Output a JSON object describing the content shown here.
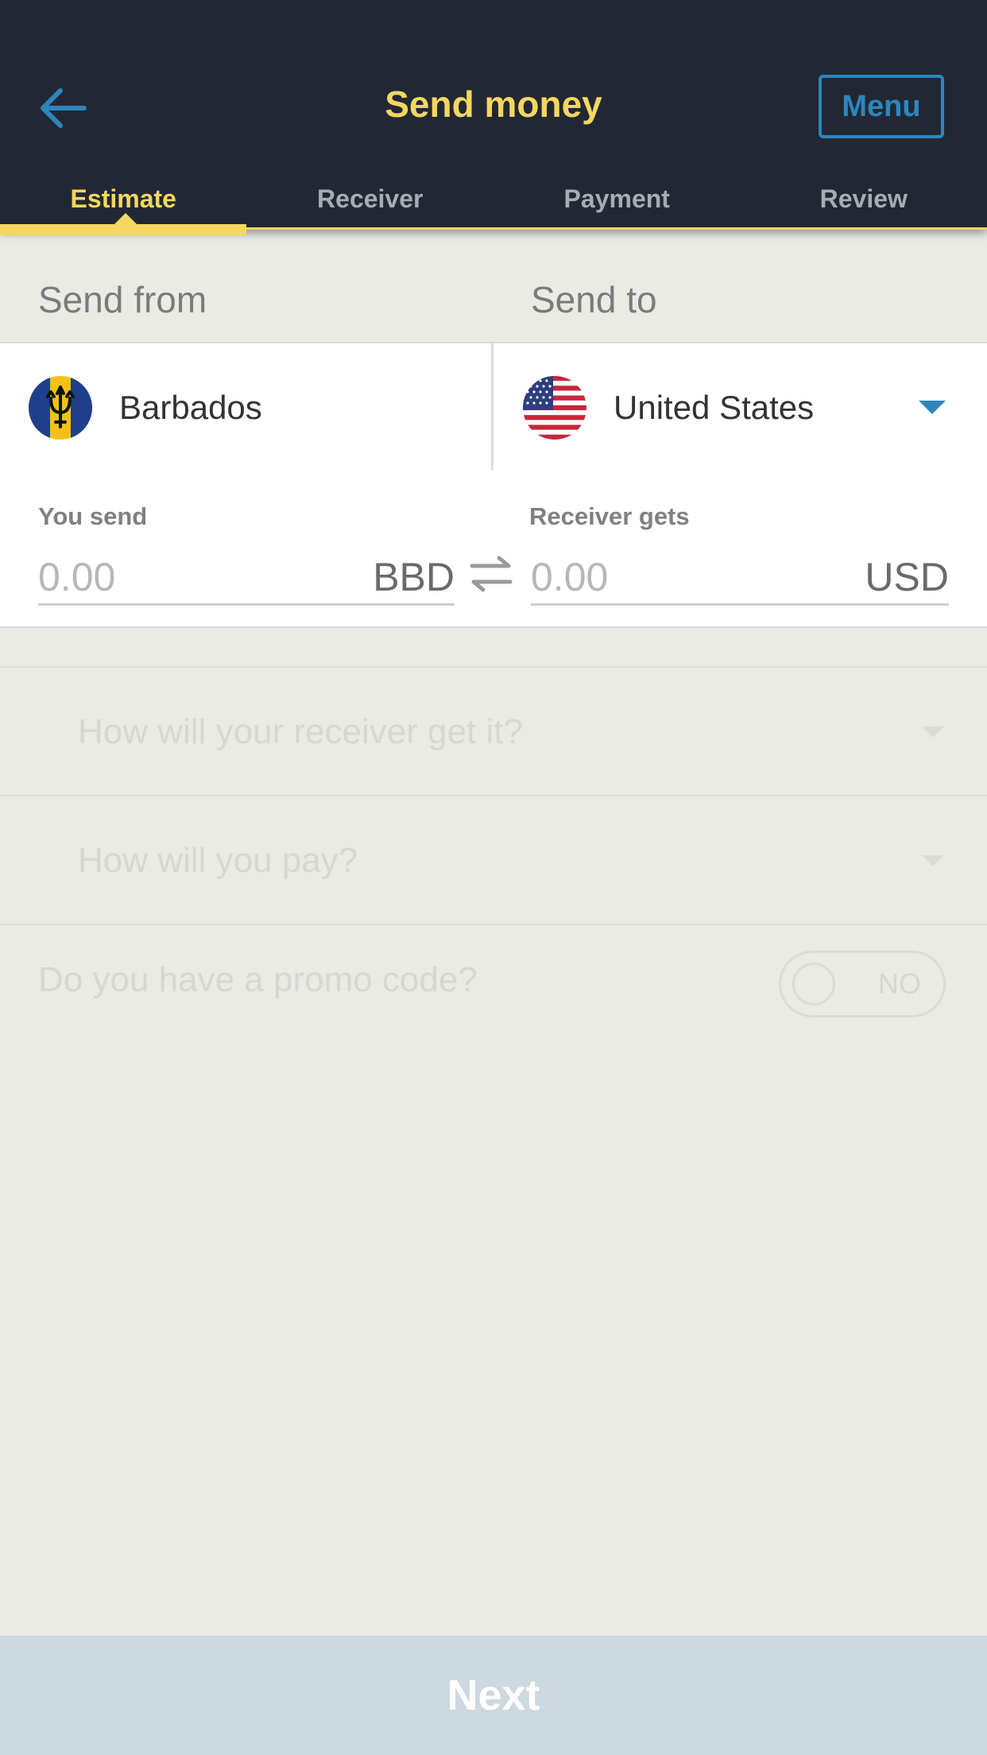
{
  "header": {
    "title": "Send money",
    "menu_label": "Menu",
    "back_icon": "arrow-left-icon"
  },
  "tabs": [
    {
      "label": "Estimate",
      "active": true
    },
    {
      "label": "Receiver",
      "active": false
    },
    {
      "label": "Payment",
      "active": false
    },
    {
      "label": "Review",
      "active": false
    }
  ],
  "countries": {
    "send_from_label": "Send from",
    "send_to_label": "Send to",
    "from": {
      "name": "Barbados",
      "flag": "barbados-flag"
    },
    "to": {
      "name": "United States",
      "flag": "us-flag"
    }
  },
  "amounts": {
    "send": {
      "label": "You send",
      "placeholder": "0.00",
      "currency": "BBD"
    },
    "receive": {
      "label": "Receiver gets",
      "placeholder": "0.00",
      "currency": "USD"
    }
  },
  "options": {
    "delivery": "How will your receiver get it?",
    "payment": "How will you pay?",
    "promo": {
      "label": "Do you have a promo code?",
      "toggle_text": "NO"
    }
  },
  "next_label": "Next",
  "colors": {
    "header_bg": "#222833",
    "accent_yellow": "#f4d760",
    "accent_blue": "#2d86c0",
    "next_bg": "#ccd9de"
  }
}
